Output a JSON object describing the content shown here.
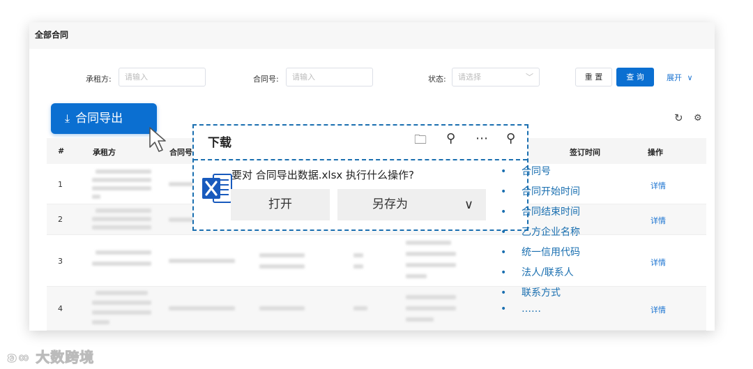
{
  "header": {
    "title": "全部合同"
  },
  "filters": {
    "tenant_label": "承租方:",
    "tenant_placeholder": "请输入",
    "contract_no_label": "合同号:",
    "contract_no_placeholder": "请输入",
    "status_label": "状态:",
    "status_placeholder": "请选择",
    "reset_label": "重 置",
    "query_label": "查 询",
    "expand_label": "展开"
  },
  "toolbar": {
    "export_label": "合同导出"
  },
  "table": {
    "columns": [
      "#",
      "承租方",
      "合同号",
      "签订时间",
      "操作"
    ],
    "rows": [
      {
        "num": "1",
        "action": "详情"
      },
      {
        "num": "2",
        "action": "详情"
      },
      {
        "num": "3",
        "action": "详情"
      },
      {
        "num": "4",
        "action": "详情"
      }
    ]
  },
  "download_panel": {
    "title": "下载",
    "question": "要对 合同导出数据.xlsx 执行什么操作?",
    "open_label": "打开",
    "save_as_label": "另存为"
  },
  "export_fields": [
    "合同号",
    "合同开始时间",
    "合同结束时间",
    "乙方企业名称",
    "统一信用代码",
    "法人/联系人",
    "联系方式",
    "……"
  ],
  "watermark": "大数跨境",
  "colors": {
    "primary": "#0b6fd1",
    "link": "#1a73d1",
    "dashed_border": "#1a6fb0"
  }
}
